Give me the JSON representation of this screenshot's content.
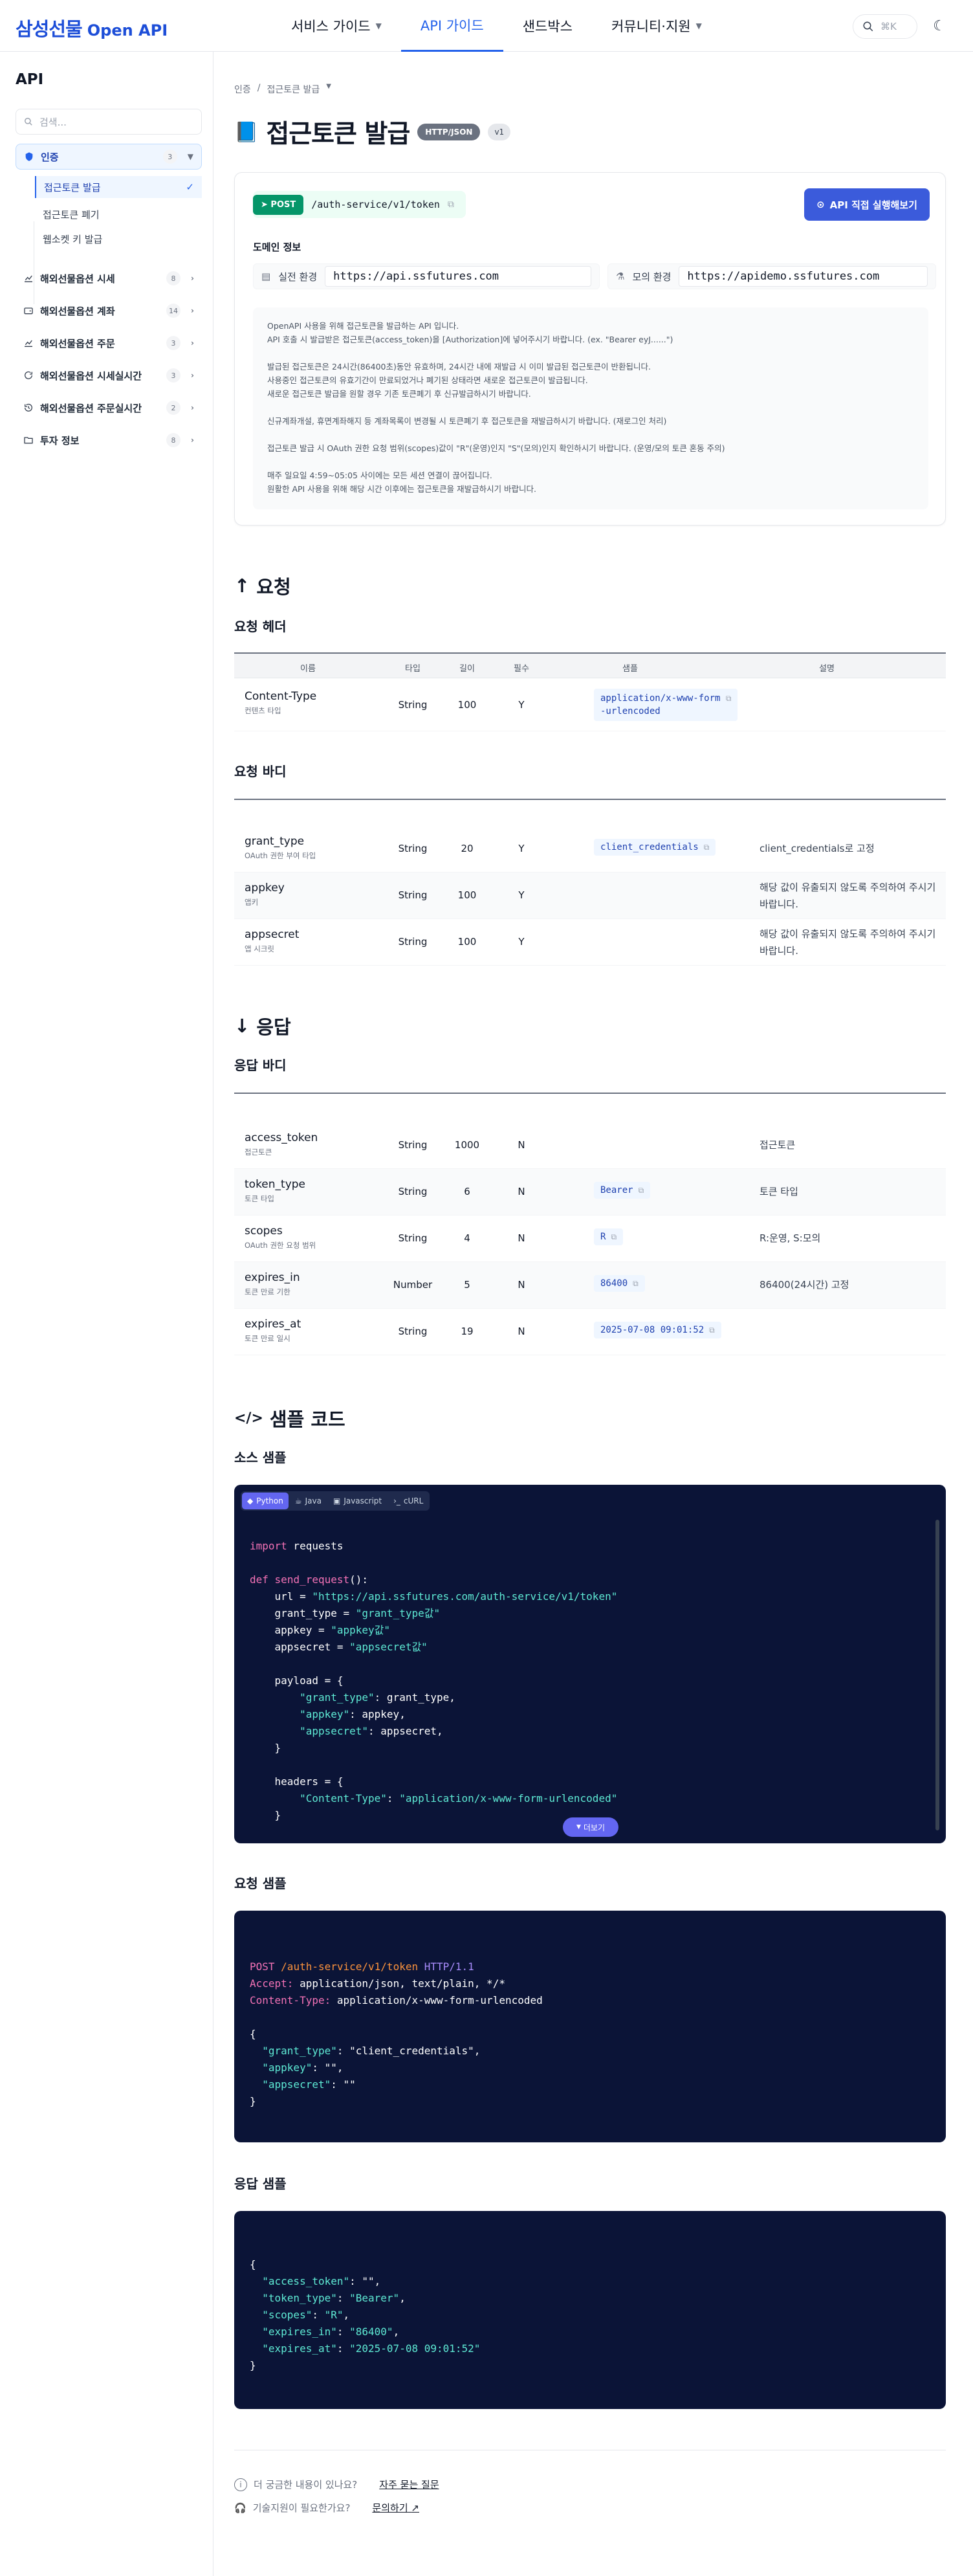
{
  "header": {
    "brand_korean": "삼성선물",
    "brand_english": "Open API",
    "nav": [
      {
        "label": "서비스 가이드",
        "chevron": true
      },
      {
        "label": "API 가이드",
        "chevron": false
      },
      {
        "label": "샌드박스",
        "chevron": false
      },
      {
        "label": "커뮤니티·지원",
        "chevron": true
      }
    ],
    "search_shortcut": "⌘K"
  },
  "sidebar": {
    "title": "API",
    "search_placeholder": "검색...",
    "groups": [
      {
        "label": "인증",
        "count": "3",
        "icon": "shield-icon"
      },
      {
        "label": "해외선물옵션 시세",
        "count": "8",
        "icon": "chart-icon"
      },
      {
        "label": "해외선물옵션 계좌",
        "count": "14",
        "icon": "wallet-icon"
      },
      {
        "label": "해외선물옵션 주문",
        "count": "3",
        "icon": "chart-icon"
      },
      {
        "label": "해외선물옵션 시세실시간",
        "count": "3",
        "icon": "refresh-icon"
      },
      {
        "label": "해외선물옵션 주문실시간",
        "count": "2",
        "icon": "history-icon"
      },
      {
        "label": "투자 정보",
        "count": "8",
        "icon": "folder-icon"
      }
    ],
    "sub_items": [
      "접근토큰 발급",
      "접근토큰 폐기",
      "웹소켓 키 발급"
    ]
  },
  "breadcrumb": [
    "인증",
    "/",
    "접근토큰 발급"
  ],
  "page": {
    "title": "접근토큰 발급",
    "badge_format": "HTTP/JSON",
    "badge_version": "v1"
  },
  "endpoint": {
    "method": "POST",
    "path": "/auth-service/v1/token",
    "try_label": "API 직접 실행해보기",
    "domain_title": "도메인 정보",
    "real_label": "실전 환경",
    "real_url": "https://api.ssfutures.com",
    "mock_label": "모의 환경",
    "mock_url": "https://apidemo.ssfutures.com",
    "desc": [
      "OpenAPI 사용을 위해 접근토큰을 발급하는 API 입니다.",
      "API 호출 시 발급받은 접근토큰(access_token)을 [Authorization]에 넣어주시기 바랍니다. (ex. \"Bearer eyJ......\")",
      "",
      "발급된 접근토큰은 24시간(86400초)동안 유효하며, 24시간 내에 재발급 시 이미 발급된 접근토큰이 반환됩니다.",
      "사용중인 접근토큰의 유효기간이 만료되었거나 폐기된 상태라면 새로운 접근토큰이 발급됩니다.",
      "새로운 접근토큰 발급을 원할 경우 기존 토큰폐기 후 신규발급하시기 바랍니다.",
      "",
      "신규계좌개설, 휴면계좌해지 등 계좌목록이 변경될 시 토큰폐기 후 접근토큰을 재발급하시기 바랍니다. (재로그인 처리)",
      "",
      "접근토큰 발급 시 OAuth 권한 요청 범위(scopes)값이 \"R\"(운영)인지 \"S\"(모의)인지 확인하시기 바랍니다. (운영/모의 토큰 혼동 주의)",
      "",
      "매주 일요일 4:59~05:05 사이에는 모든 세션 연결이 끊어집니다.",
      "원활한 API 사용을 위해 해당 시간 이후에는 접근토큰을 재발급하시기 바랍니다."
    ]
  },
  "request": {
    "heading": "요청",
    "header_title": "요청 헤더",
    "columns": [
      "이름",
      "타입",
      "길이",
      "필수",
      "샘플",
      "설명"
    ],
    "headers": [
      {
        "name": "Content-Type",
        "sub": "컨텐츠 타입",
        "type": "String",
        "len": "100",
        "req": "Y",
        "sample_line1": "application/x-www-form",
        "sample_line2": "-urlencoded",
        "desc": ""
      }
    ],
    "body_title": "요청 바디",
    "body": [
      {
        "name": "grant_type",
        "sub": "OAuth 권한 부여 타입",
        "type": "String",
        "len": "20",
        "req": "Y",
        "sample": "client_credentials",
        "desc": "client_credentials로 고정"
      },
      {
        "name": "appkey",
        "sub": "앱키",
        "type": "String",
        "len": "100",
        "req": "Y",
        "sample": "",
        "desc": "해당 값이 유출되지 않도록 주의하여 주시기 바랍니다."
      },
      {
        "name": "appsecret",
        "sub": "앱 시크릿",
        "type": "String",
        "len": "100",
        "req": "Y",
        "sample": "",
        "desc": "해당 값이 유출되지 않도록 주의하여 주시기 바랍니다."
      }
    ]
  },
  "response": {
    "heading": "응답",
    "body_title": "응답 바디",
    "body": [
      {
        "name": "access_token",
        "sub": "접근토큰",
        "type": "String",
        "len": "1000",
        "req": "N",
        "sample": "",
        "desc": "접근토큰"
      },
      {
        "name": "token_type",
        "sub": "토큰 타입",
        "type": "String",
        "len": "6",
        "req": "N",
        "sample": "Bearer",
        "desc": "토큰 타입"
      },
      {
        "name": "scopes",
        "sub": "OAuth 권한 요청 범위",
        "type": "String",
        "len": "4",
        "req": "N",
        "sample": "R",
        "desc": "R:운영, S:모의"
      },
      {
        "name": "expires_in",
        "sub": "토큰 만료 기한",
        "type": "Number",
        "len": "5",
        "req": "N",
        "sample": "86400",
        "desc": "86400(24시간) 고정"
      },
      {
        "name": "expires_at",
        "sub": "토큰 만료 일시",
        "type": "String",
        "len": "19",
        "req": "N",
        "sample": "2025-07-08 09:01:52",
        "desc": ""
      }
    ]
  },
  "samples": {
    "heading": "샘플 코드",
    "source_title": "소스 샘플",
    "langs": [
      "Python",
      "Java",
      "Javascript",
      "cURL"
    ],
    "more_label": "더보기",
    "request_title": "요청 샘플",
    "response_title": "응답 샘플"
  },
  "footer": {
    "q1": "더 궁금한 내용이 있나요?",
    "q1_link": "자주 묻는 질문",
    "q2": "기술지원이 필요한가요?",
    "q2_link": "문의하기"
  },
  "colors": {
    "accent": "#2563eb",
    "post": "#059669",
    "code_bg": "#0b1437"
  }
}
